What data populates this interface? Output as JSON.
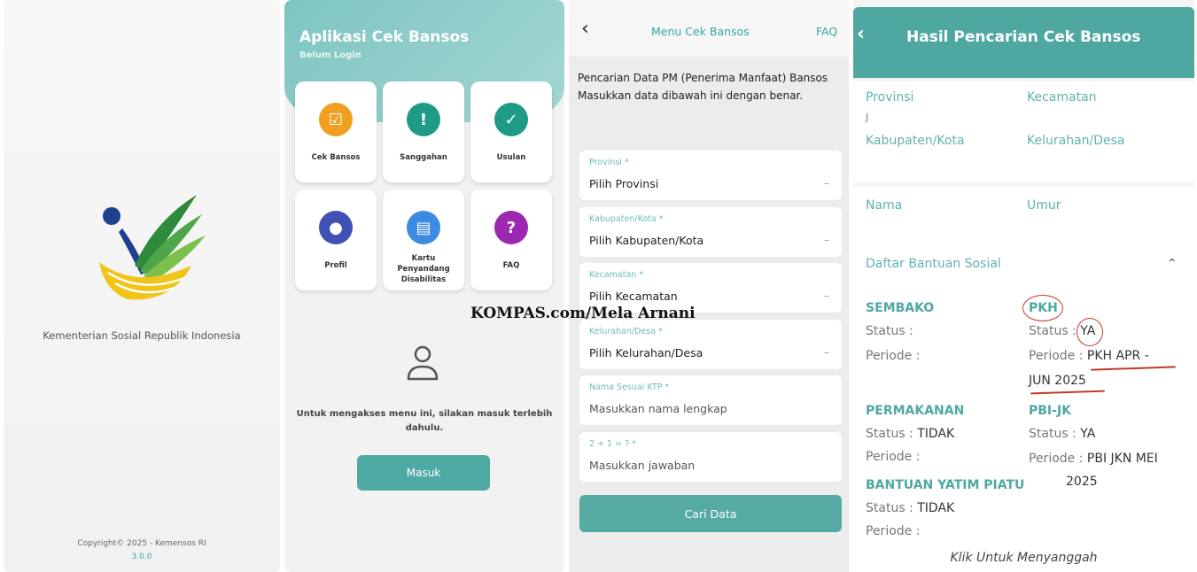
{
  "splash": {
    "org_name": "Kementerian Sosial Republik Indonesia",
    "copyright": "Copyright© 2025 - Kemensos RI",
    "version": "3.0.0"
  },
  "menu": {
    "title": "Aplikasi Cek Bansos",
    "subtitle": "Belum Login",
    "tiles": [
      {
        "label": "Cek Bansos",
        "color": "#f0a020",
        "icon": "checklist-icon"
      },
      {
        "label": "Sanggahan",
        "color": "#1f9a86",
        "icon": "message-icon"
      },
      {
        "label": "Usulan",
        "color": "#1f9a86",
        "icon": "user-check-icon"
      },
      {
        "label": "Profil",
        "color": "#3f51b5",
        "icon": "profile-icon"
      },
      {
        "label": "Kartu Penyandang Disabilitas",
        "color": "#3d8be0",
        "icon": "card-icon"
      },
      {
        "label": "FAQ",
        "color": "#9c27b0",
        "icon": "question-icon"
      }
    ],
    "login_message": "Untuk mengakses menu ini, silakan masuk terlebih dahulu.",
    "login_button": "Masuk"
  },
  "form": {
    "title": "Menu Cek Bansos",
    "faq": "FAQ",
    "intro": "Pencarian Data PM (Penerima Manfaat) Bansos",
    "intro2": "Masukkan data dibawah ini dengan benar.",
    "fields": [
      {
        "label": "Provinsi *",
        "value": "Pilih Provinsi",
        "dropdown": true
      },
      {
        "label": "Kabupaten/Kota *",
        "value": "Pilih Kabupaten/Kota",
        "dropdown": true
      },
      {
        "label": "Kecamatan *",
        "value": "Pilih Kecamatan",
        "dropdown": true
      },
      {
        "label": "Kelurahan/Desa *",
        "value": "Pilih Kelurahan/Desa",
        "dropdown": true
      },
      {
        "label": "Nama Sesuai KTP *",
        "value": "Masukkan nama lengkap",
        "dropdown": false
      },
      {
        "label": "2 + 1 = ? *",
        "value": "Masukkan jawaban",
        "dropdown": false
      }
    ],
    "submit": "Cari Data"
  },
  "result": {
    "title": "Hasil Pencarian Cek Bansos",
    "provinsi_label": "Provinsi",
    "provinsi_value": "J",
    "kecamatan_label": "Kecamatan",
    "kabupaten_label": "Kabupaten/Kota",
    "kelurahan_label": "Kelurahan/Desa",
    "nama_label": "Nama",
    "umur_label": "Umur",
    "daftar_label": "Daftar Bantuan Sosial",
    "programs": {
      "sembako": {
        "name": "SEMBAKO",
        "status_label": "Status :",
        "periode_label": "Periode :"
      },
      "pkh": {
        "name": "PKH",
        "status_label": "Status :",
        "status_value": "YA",
        "periode_label": "Periode :",
        "periode_value": "PKH APR -",
        "periode_value2": "JUN 2025"
      },
      "permakanan": {
        "name": "PERMAKANAN",
        "status_label": "Status :",
        "status_value": "TIDAK",
        "periode_label": "Periode :"
      },
      "pbijk": {
        "name": "PBI-JK",
        "status_label": "Status :",
        "status_value": "YA",
        "periode_label": "Periode :",
        "periode_value": "PBI JKN MEI",
        "periode_value2": "2025"
      },
      "yatim": {
        "name": "BANTUAN YATIM PIATU",
        "status_label": "Status :",
        "status_value": "TIDAK",
        "periode_label": "Periode :"
      }
    },
    "klik": "Klik Untuk Menyanggah"
  },
  "watermark": "KOMPAS.com/Mela Arnani"
}
